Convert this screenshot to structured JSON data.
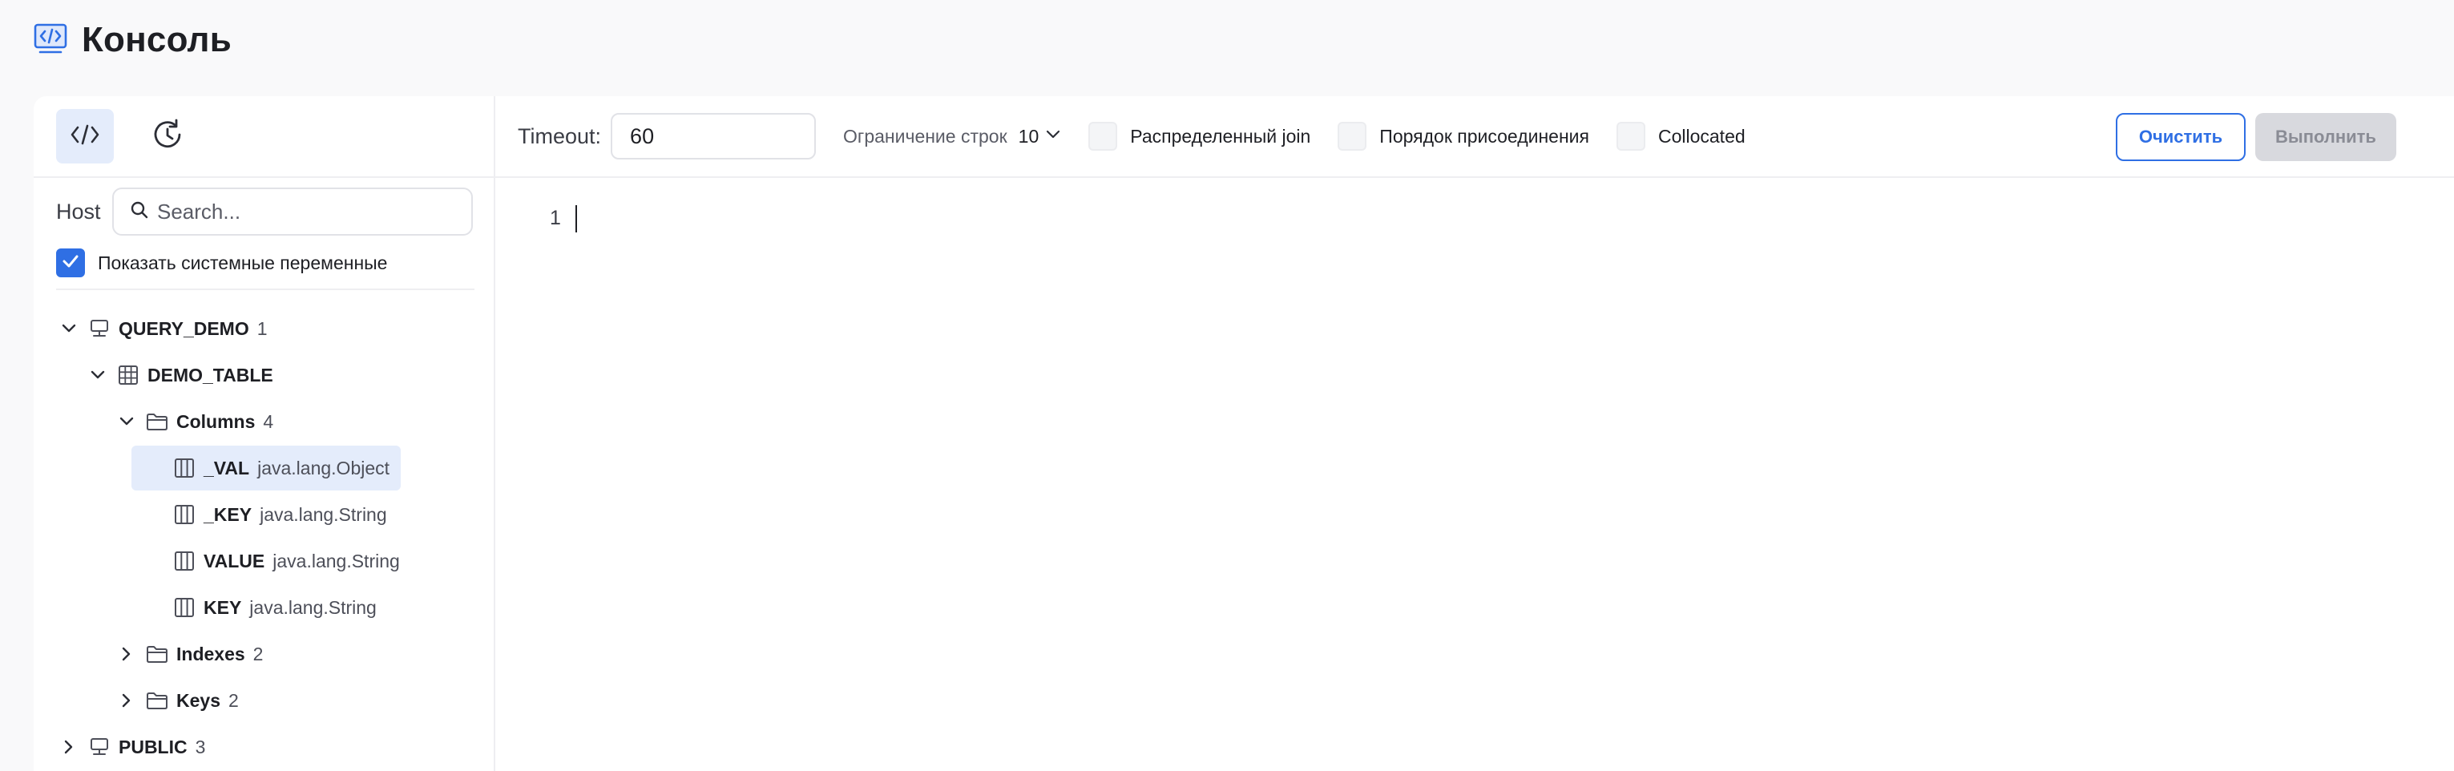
{
  "header": {
    "title": "Консоль",
    "icon": "code-monitor-icon"
  },
  "sidebar": {
    "modes": [
      {
        "name": "code-mode",
        "icon": "code-icon",
        "active": true
      },
      {
        "name": "history-mode",
        "icon": "history-icon",
        "active": false
      }
    ],
    "host_label": "Host",
    "search_placeholder": "Search...",
    "system_vars": {
      "label": "Показать системные переменные",
      "checked": true
    },
    "tree": [
      {
        "name": "QUERY_DEMO",
        "meta": "1",
        "type": "schema",
        "expanded": true,
        "level": 0
      },
      {
        "name": "DEMO_TABLE",
        "meta": "",
        "type": "table",
        "expanded": true,
        "level": 1
      },
      {
        "name": "Columns",
        "meta": "4",
        "type": "folder",
        "expanded": true,
        "level": 2
      },
      {
        "name": "_VAL",
        "meta": "java.lang.Object",
        "type": "column",
        "level": 3,
        "selected": true
      },
      {
        "name": "_KEY",
        "meta": "java.lang.String",
        "type": "column",
        "level": 3
      },
      {
        "name": "VALUE",
        "meta": "java.lang.String",
        "type": "column",
        "level": 3
      },
      {
        "name": "KEY",
        "meta": "java.lang.String",
        "type": "column",
        "level": 3
      },
      {
        "name": "Indexes",
        "meta": "2",
        "type": "folder",
        "expanded": false,
        "level": 2
      },
      {
        "name": "Keys",
        "meta": "2",
        "type": "folder",
        "expanded": false,
        "level": 2
      },
      {
        "name": "PUBLIC",
        "meta": "3",
        "type": "schema",
        "expanded": false,
        "level": 0
      }
    ]
  },
  "toolbar": {
    "timeout_label": "Timeout:",
    "timeout_value": "60",
    "limit_label": "Ограничение строк",
    "limit_value": "10",
    "options": [
      {
        "label": "Распределенный join",
        "checked": false
      },
      {
        "label": "Порядок присоединения",
        "checked": false
      },
      {
        "label": "Collocated",
        "checked": false
      }
    ],
    "clear_label": "Очистить",
    "run_label": "Выполнить"
  },
  "editor": {
    "line_numbers": [
      "1"
    ]
  },
  "colors": {
    "accent": "#2f6fe4",
    "selected_bg": "#e4ecfb",
    "disabled_bg": "#d8d9de"
  }
}
